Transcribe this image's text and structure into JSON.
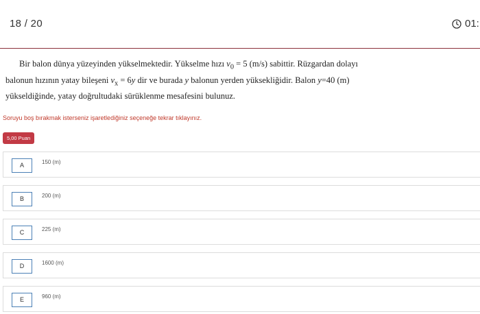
{
  "header": {
    "counter": "18 / 20",
    "timer": "01:"
  },
  "question": {
    "line1_a": "Bir balon dünya yüzeyinden yükselmektedir. Yükselme hızı ",
    "v0_symbol": "v",
    "v0_sub": "0",
    "v0_eq": " = 5",
    "line1_b": " (m/s) sabittir. Rüzgardan dolayı",
    "line2_a": "balonun hızının yatay bileşeni ",
    "vx_symbol": "v",
    "vx_sub": "x",
    "vx_eq": " = 6",
    "vx_y": "y",
    "line2_b": " dir ve burada ",
    "line2_y": "y",
    "line2_c": " balonun yerden yüksekliğidir. Balon ",
    "line2_y2": "y",
    "line2_d": "=40 (m)",
    "line3": "yükseldiğinde, yatay doğrultudaki sürüklenme mesafesini bulunuz."
  },
  "warning": "Soruyu boş bırakmak isterseniz işaretlediğiniz seçeneğe tekrar tıklayınız.",
  "points_badge": "5,00 Puan",
  "options": [
    {
      "letter": "A",
      "text": "150 (m)"
    },
    {
      "letter": "B",
      "text": "200 (m)"
    },
    {
      "letter": "C",
      "text": "225 (m)"
    },
    {
      "letter": "D",
      "text": "1600 (m)"
    },
    {
      "letter": "E",
      "text": "960 (m)"
    }
  ],
  "colors": {
    "accent": "#c23a45",
    "divider": "#8b2f3a",
    "option_border": "#4a7fb5",
    "warning_text": "#c0392b"
  },
  "icons": {
    "timer": "clock-icon"
  }
}
